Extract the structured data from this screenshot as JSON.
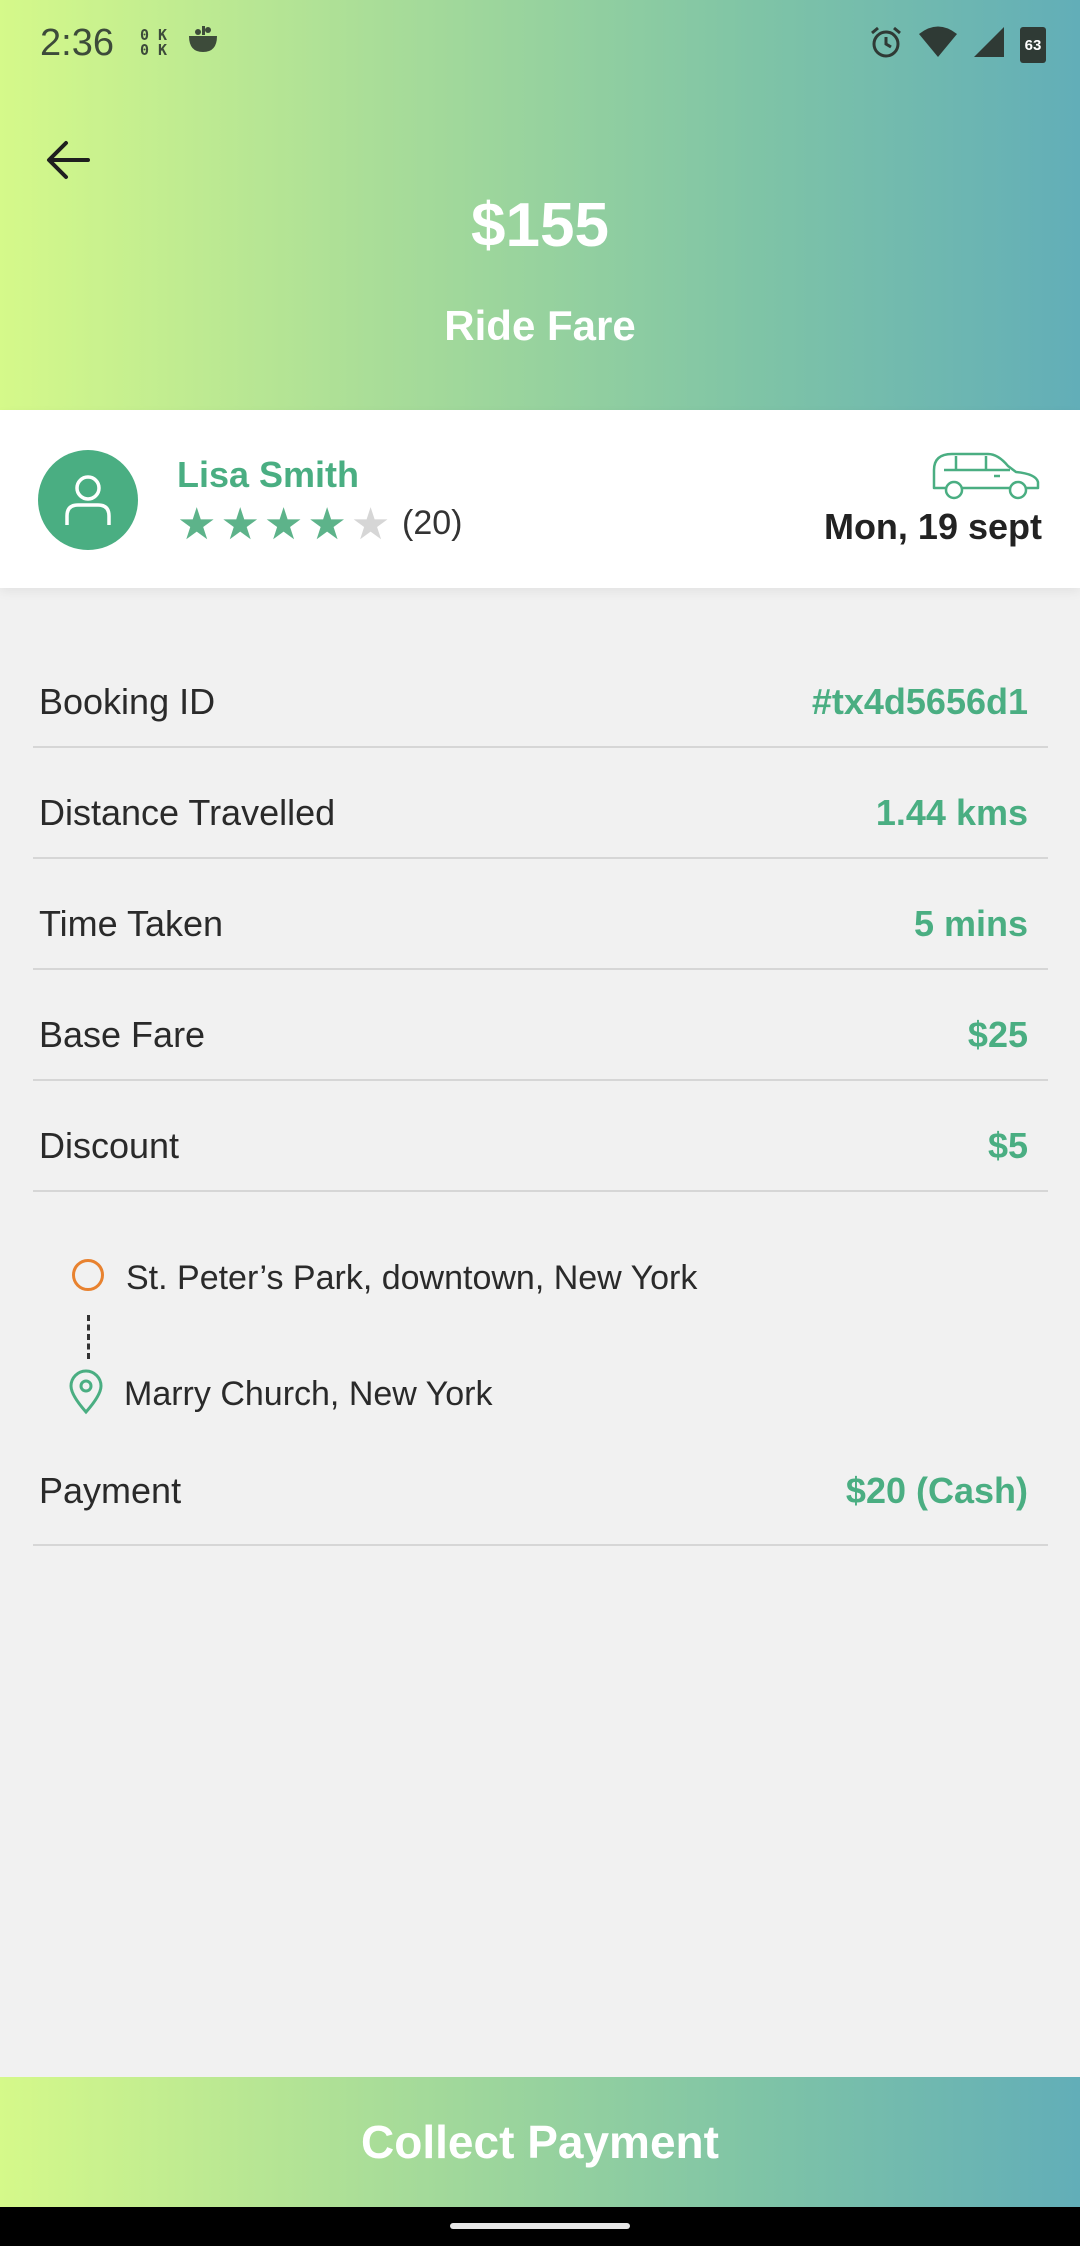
{
  "status_bar": {
    "time": "2:36",
    "ok_icon_text": "0K\n0K",
    "battery_level": "63"
  },
  "header": {
    "fare_amount": "$155",
    "fare_label": "Ride Fare"
  },
  "rider": {
    "name": "Lisa Smith",
    "rating_stars": 4,
    "rating_max": 5,
    "rating_count": "(20)",
    "date": "Mon, 19 sept"
  },
  "details": [
    {
      "label": "Booking ID",
      "value": "#tx4d5656d1"
    },
    {
      "label": "Distance Travelled",
      "value": "1.44 kms"
    },
    {
      "label": "Time Taken",
      "value": "5 mins"
    },
    {
      "label": "Base Fare",
      "value": "$25"
    },
    {
      "label": "Discount",
      "value": "$5"
    }
  ],
  "route": {
    "origin": "St. Peter’s Park, downtown, New York",
    "destination": "Marry Church, New York"
  },
  "payment": {
    "label": "Payment",
    "value": "$20 (Cash)"
  },
  "actions": {
    "collect_label": "Collect Payment"
  },
  "colors": {
    "accent": "#4aae82",
    "origin": "#e8822f",
    "gradient_start": "#d5f98a",
    "gradient_end": "#62aeb8"
  },
  "icons": [
    "back-arrow-icon",
    "user-icon",
    "star-icon",
    "car-icon",
    "origin-circle-icon",
    "location-pin-icon",
    "alarm-icon",
    "wifi-icon",
    "signal-icon",
    "battery-icon"
  ]
}
